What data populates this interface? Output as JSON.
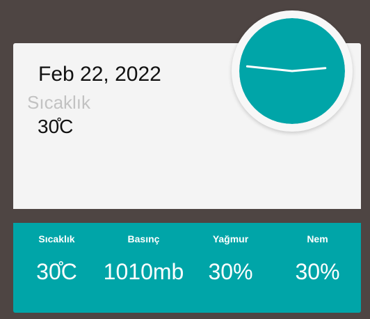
{
  "colors": {
    "background": "#4e4543",
    "card": "#f4f4f4",
    "accent": "#00a5a8",
    "clock_hands": "#ffffff"
  },
  "weather": {
    "date": "Feb 22, 2022",
    "temperature_label": "Sıcaklık",
    "temperature_value": "30̊C"
  },
  "clock": {
    "hour_hand_angle_deg": 276,
    "minute_hand_angle_deg": 85
  },
  "stats": [
    {
      "label": "Sıcaklık",
      "value": "30̊C"
    },
    {
      "label": "Basınç",
      "value": "1010mb"
    },
    {
      "label": "Yağmur",
      "value": "30%"
    },
    {
      "label": "Nem",
      "value": "30%"
    }
  ]
}
